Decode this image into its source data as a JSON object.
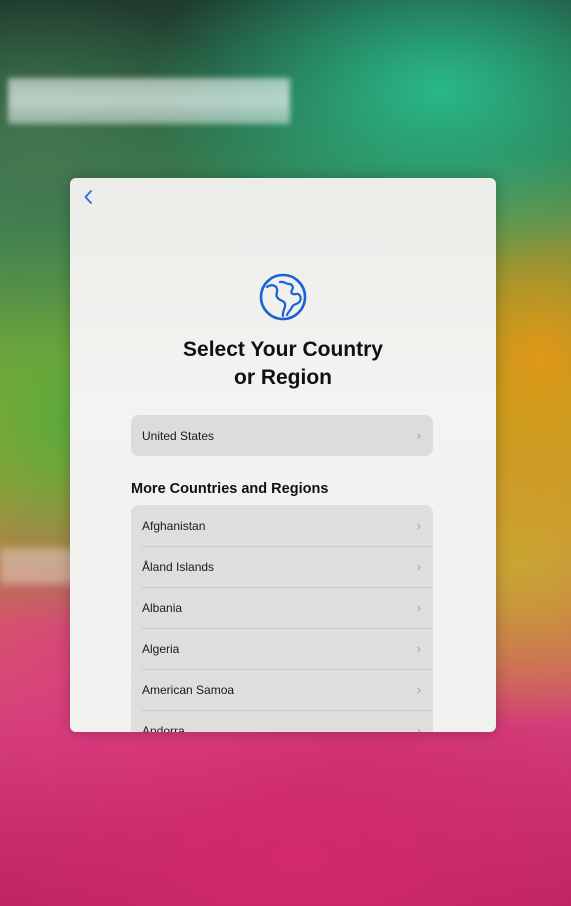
{
  "screen": {
    "back_icon": "chevron-left-icon",
    "globe_icon": "globe-icon",
    "title_line1": "Select Your Country",
    "title_line2": "or Region",
    "featured": {
      "label": "United States"
    },
    "section_title": "More Countries and Regions",
    "countries": [
      {
        "label": "Afghanistan"
      },
      {
        "label": "Åland Islands"
      },
      {
        "label": "Albania"
      },
      {
        "label": "Algeria"
      },
      {
        "label": "American Samoa"
      },
      {
        "label": "Andorra"
      }
    ],
    "chevron": "›"
  },
  "colors": {
    "accent": "#1a62d6",
    "row_bg": "#dcdcda",
    "screen_bg": "#f1f1ef"
  }
}
